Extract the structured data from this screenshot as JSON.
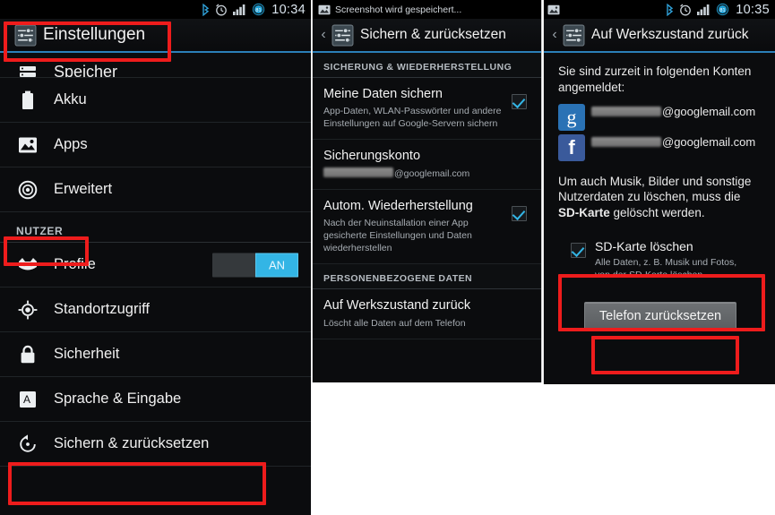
{
  "left": {
    "statusbar": {
      "icons": [
        "bluetooth-icon",
        "alarm-icon",
        "signal-icon",
        "battery-icon"
      ],
      "battery_level": "81",
      "time": "10:34"
    },
    "header": {
      "title": "Einstellungen",
      "icon": "settings-sliders-icon"
    },
    "items": [
      {
        "label": "Speicher",
        "icon": "storage-icon"
      },
      {
        "label": "Akku",
        "icon": "battery-icon"
      },
      {
        "label": "Apps",
        "icon": "apps-image-icon"
      },
      {
        "label": "Erweitert",
        "icon": "advanced-target-icon"
      }
    ],
    "section_label": "NUTZER",
    "items2": [
      {
        "label": "Profile",
        "icon": "profile-mask-icon",
        "toggle": "AN"
      },
      {
        "label": "Standortzugriff",
        "icon": "location-crosshair-icon"
      },
      {
        "label": "Sicherheit",
        "icon": "lock-icon"
      },
      {
        "label": "Sprache & Eingabe",
        "icon": "language-a-icon"
      },
      {
        "label": "Sichern & zurücksetzen",
        "icon": "backup-restore-icon"
      }
    ]
  },
  "middle": {
    "statusbar": {
      "notification_icon": "image-saved-icon",
      "notification": "Screenshot wird gespeichert..."
    },
    "header": {
      "title": "Sichern & zurücksetzen",
      "icon": "settings-sliders-icon",
      "back": "‹"
    },
    "category1": "SICHERUNG & WIEDERHERSTELLUNG",
    "prefs": [
      {
        "title": "Meine Daten sichern",
        "summary": "App-Daten, WLAN-Passwörter und andere Einstellungen auf Google-Servern sichern",
        "checked": true
      },
      {
        "title": "Sicherungskonto",
        "summary": "@googlemail.com",
        "redacted": true,
        "checked": null
      },
      {
        "title": "Autom. Wiederherstellung",
        "summary": "Nach der Neuinstallation einer App gesicherte Einstellungen und Daten wiederherstellen",
        "checked": true
      }
    ],
    "category2": "PERSONENBEZOGENE DATEN",
    "prefs2": [
      {
        "title": "Auf Werkszustand zurück",
        "summary": "Löscht alle Daten auf dem Telefon",
        "checked": null
      }
    ]
  },
  "right": {
    "statusbar": {
      "notification_icon": "image-saved-icon",
      "icons": [
        "bluetooth-icon",
        "alarm-icon",
        "signal-icon",
        "battery-icon"
      ],
      "battery_level": "81",
      "time": "10:35"
    },
    "header": {
      "title": "Auf Werkszustand zurück",
      "icon": "settings-sliders-icon",
      "back": "‹"
    },
    "intro": "Sie sind zurzeit in folgenden Konten angemeldet:",
    "accounts": [
      {
        "provider": "google-icon",
        "glyph": "g",
        "email_suffix": "@googlemail.com"
      },
      {
        "provider": "facebook-icon",
        "glyph": "f",
        "email_suffix": "@googlemail.com"
      }
    ],
    "notice_pre": "Um auch Musik, Bilder und sonstige Nutzerdaten zu löschen, muss die ",
    "notice_bold": "SD-Karte",
    "notice_post": " gelöscht werden.",
    "sd_option": {
      "title": "SD-Karte löschen",
      "summary": "Alle Daten, z. B. Musik und Fotos, von der SD-Karte löschen",
      "checked": true
    },
    "reset_button": "Telefon zurücksetzen"
  },
  "colors": {
    "accent": "#33b5e5",
    "annotation": "#ee1c1c",
    "panel_bg": "#0b0c0e",
    "google_blue": "#2a72b5",
    "facebook_blue": "#3a5a9b"
  }
}
